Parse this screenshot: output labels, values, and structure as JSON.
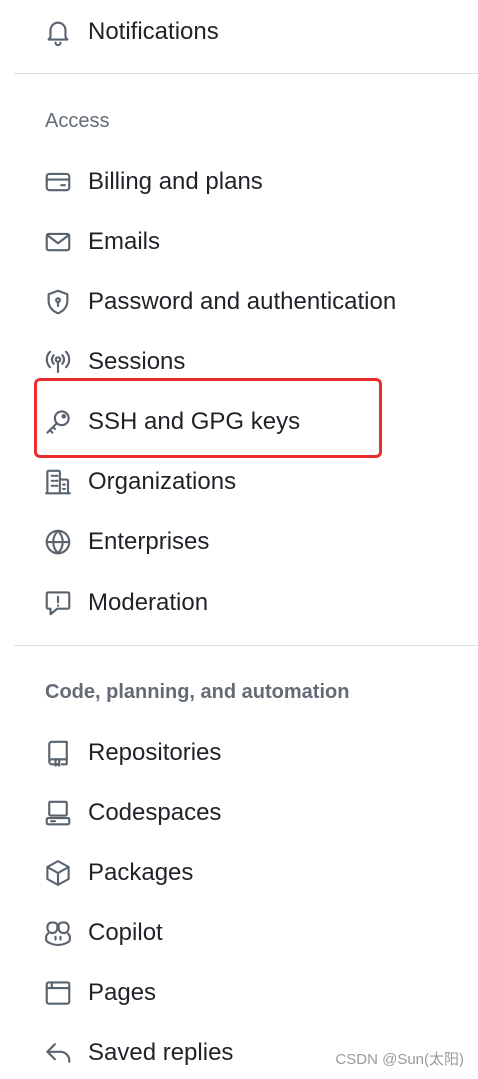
{
  "top_items": [
    {
      "label": "Notifications",
      "icon": "bell-icon"
    }
  ],
  "access_section": {
    "heading": "Access",
    "items": [
      {
        "label": "Billing and plans",
        "icon": "credit-card-icon"
      },
      {
        "label": "Emails",
        "icon": "mail-icon"
      },
      {
        "label": "Password and authentication",
        "icon": "shield-lock-icon"
      },
      {
        "label": "Sessions",
        "icon": "broadcast-icon"
      },
      {
        "label": "SSH and GPG keys",
        "icon": "key-icon",
        "highlighted": true
      },
      {
        "label": "Organizations",
        "icon": "organization-icon"
      },
      {
        "label": "Enterprises",
        "icon": "globe-icon"
      },
      {
        "label": "Moderation",
        "icon": "report-icon"
      }
    ]
  },
  "code_section": {
    "heading": "Code, planning, and automation",
    "items": [
      {
        "label": "Repositories",
        "icon": "repo-icon"
      },
      {
        "label": "Codespaces",
        "icon": "codespaces-icon"
      },
      {
        "label": "Packages",
        "icon": "package-icon"
      },
      {
        "label": "Copilot",
        "icon": "copilot-icon"
      },
      {
        "label": "Pages",
        "icon": "browser-icon"
      },
      {
        "label": "Saved replies",
        "icon": "reply-icon"
      }
    ]
  },
  "highlight_color": "#ea2c2c",
  "watermark": "CSDN @Sun(太阳)"
}
